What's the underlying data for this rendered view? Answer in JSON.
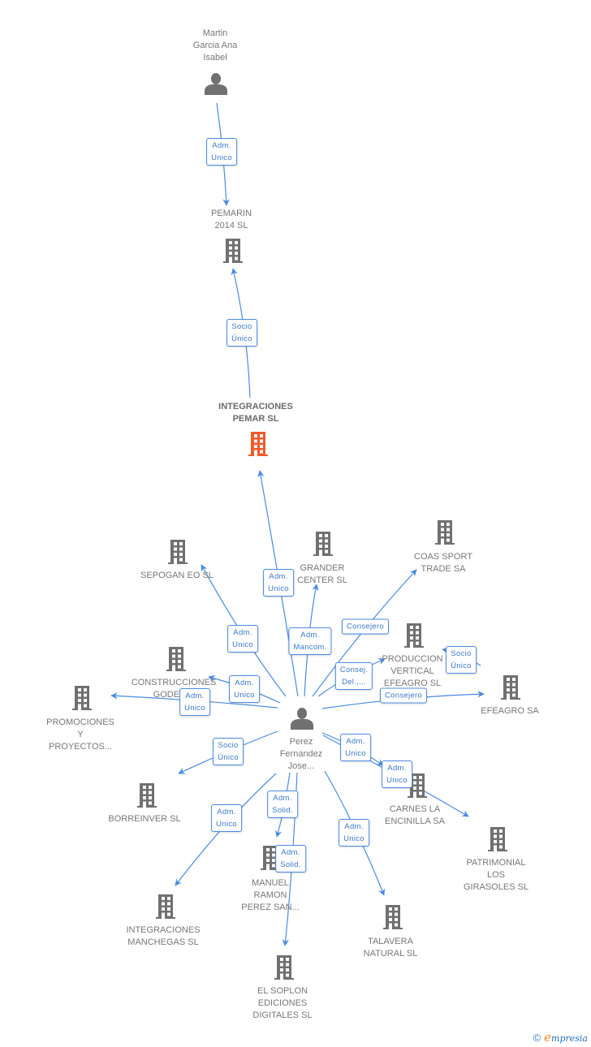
{
  "colors": {
    "edge": "#4a8be0",
    "node_gray": "#707070",
    "focus_node": "#f15a2b",
    "label_text": "#777777"
  },
  "nodes": [
    {
      "id": "martin",
      "type": "person",
      "label": "Martin\nGarcia Ana\nIsabel",
      "focus": false
    },
    {
      "id": "pemarin",
      "type": "company",
      "label": "PEMARIN\n2014  SL",
      "focus": false
    },
    {
      "id": "integraciones_pemar",
      "type": "company",
      "label": "INTEGRACIONES\nPEMAR SL",
      "focus": true
    },
    {
      "id": "sepogan",
      "type": "company",
      "label": "SEPOGAN EO SL",
      "focus": false
    },
    {
      "id": "grander",
      "type": "company",
      "label": "GRANDER\nCENTER SL",
      "focus": false
    },
    {
      "id": "coas",
      "type": "company",
      "label": "COAS SPORT\nTRADE SA",
      "focus": false
    },
    {
      "id": "construcciones",
      "type": "company",
      "label": "CONSTRUCCIONES\nGODEM...",
      "focus": false
    },
    {
      "id": "produccion",
      "type": "company",
      "label": "PRODUCCION\nVERTICAL\nEFEAGRO  SL",
      "focus": false
    },
    {
      "id": "efeagro",
      "type": "company",
      "label": "EFEAGRO SA",
      "focus": false
    },
    {
      "id": "promociones",
      "type": "company",
      "label": "PROMOCIONES\nY\nPROYECTOS...",
      "focus": false
    },
    {
      "id": "perez",
      "type": "person",
      "label": "Perez\nFernandez\nJose...",
      "focus": false
    },
    {
      "id": "borreinver",
      "type": "company",
      "label": "BORREINVER SL",
      "focus": false
    },
    {
      "id": "carnes",
      "type": "company",
      "label": "CARNES LA\nENCINILLA SA",
      "focus": false
    },
    {
      "id": "patrimonial",
      "type": "company",
      "label": "PATRIMONIAL\nLOS\nGIRASOLES SL",
      "focus": false
    },
    {
      "id": "manuel",
      "type": "company",
      "label": "MANUEL\nRAMON\nPEREZ SAN...",
      "focus": false
    },
    {
      "id": "integraciones_manchegas",
      "type": "company",
      "label": "INTEGRACIONES\nMANCHEGAS SL",
      "focus": false
    },
    {
      "id": "talavera",
      "type": "company",
      "label": "TALAVERA\nNATURAL SL",
      "focus": false
    },
    {
      "id": "soplon",
      "type": "company",
      "label": "EL SOPLON\nEDICIONES\nDIGITALES SL",
      "focus": false
    }
  ],
  "edges": [
    {
      "from": "martin",
      "to": "pemarin",
      "label": "Adm.\nUnico"
    },
    {
      "from": "integraciones_pemar",
      "to": "pemarin",
      "label": "Socio\nÚnico"
    },
    {
      "from": "perez",
      "to": "integraciones_pemar",
      "label": "Adm.\nUnico"
    },
    {
      "from": "perez",
      "to": "sepogan",
      "label": "Adm.\nUnico"
    },
    {
      "from": "perez",
      "to": "grander",
      "label": "Adm.\nMancom."
    },
    {
      "from": "perez",
      "to": "coas",
      "label": "Consejero"
    },
    {
      "from": "perez",
      "to": "construcciones",
      "label": "Adm.\nUnico"
    },
    {
      "from": "perez",
      "to": "produccion",
      "label": "Consej.\nDel.,..."
    },
    {
      "from": "efeagro",
      "to": "produccion",
      "label": "Socio\nÚnico"
    },
    {
      "from": "perez",
      "to": "efeagro",
      "label": "Consejero"
    },
    {
      "from": "perez",
      "to": "promociones",
      "label": "Adm.\nUnico"
    },
    {
      "from": "perez",
      "to": "borreinver",
      "label": "Socio\nÚnico"
    },
    {
      "from": "perez",
      "to": "carnes",
      "label": "Adm.\nUnico"
    },
    {
      "from": "perez",
      "to": "patrimonial",
      "label": "Adm.\nUnico"
    },
    {
      "from": "perez",
      "to": "manuel",
      "label": "Adm.\nSolid."
    },
    {
      "from": "perez",
      "to": "soplon",
      "label": "Adm.\nSolid."
    },
    {
      "from": "perez",
      "to": "integraciones_manchegas",
      "label": "Adm.\nUnico"
    },
    {
      "from": "perez",
      "to": "talavera",
      "label": "Adm.\nUnico"
    }
  ],
  "footer": {
    "copyright_symbol": "©",
    "brand_initial": "e",
    "brand_rest": "mpresia"
  }
}
